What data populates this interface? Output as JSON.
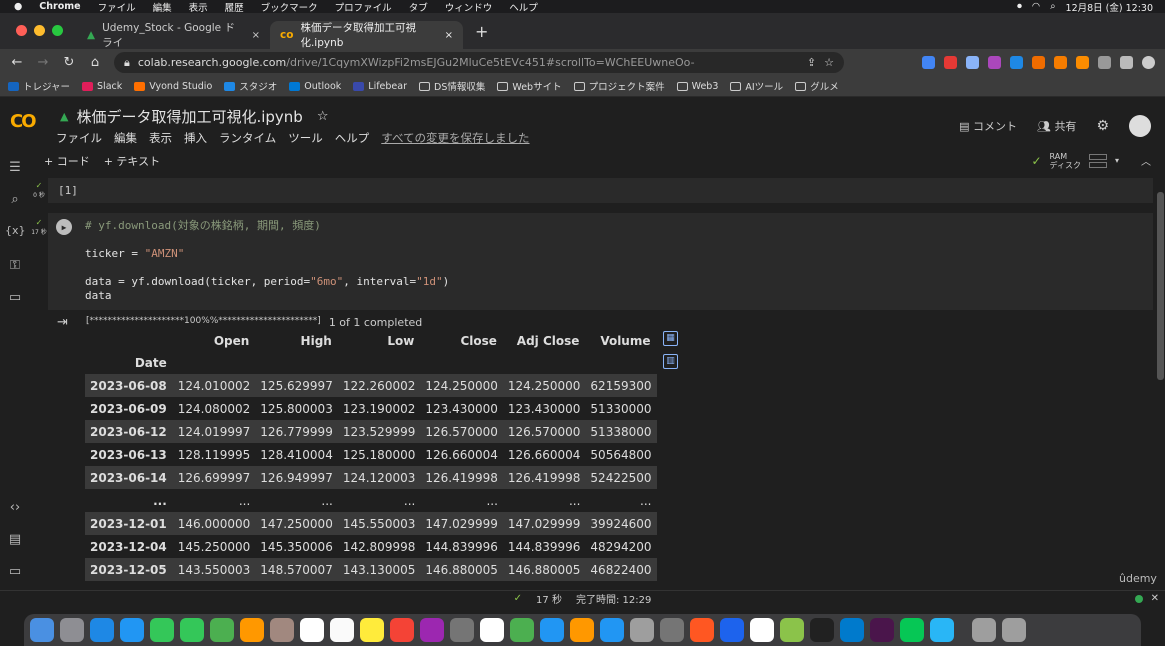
{
  "mac_menubar": {
    "app": "Chrome",
    "items": [
      "ファイル",
      "編集",
      "表示",
      "履歴",
      "ブックマーク",
      "プロファイル",
      "タブ",
      "ウィンドウ",
      "ヘルプ"
    ],
    "clock": "12月8日 (金)  12:30"
  },
  "tabs": [
    {
      "label": "Udemy_Stock - Google ドライ",
      "close": "×"
    },
    {
      "label": "株価データ取得加工可視化.ipynb",
      "close": "×"
    }
  ],
  "new_tab": "+",
  "address": {
    "host": "colab.research.google.com",
    "path": "/drive/1CqymXWizpFi2msEJGu2MluCe5tEVc451#scrollTo=WChEEUwneOo-"
  },
  "bookmarks": [
    "トレジャー",
    "Slack",
    "Vyond Studio",
    "スタジオ",
    "Outlook",
    "Lifebear",
    "DS情報収集",
    "Webサイト",
    "プロジェクト案件",
    "Web3",
    "AIツール",
    "グルメ"
  ],
  "colab": {
    "logo": "CO",
    "title": "株価データ取得加工可視化.ipynb",
    "star": "☆",
    "menus": [
      "ファイル",
      "編集",
      "表示",
      "挿入",
      "ランタイム",
      "ツール",
      "ヘルプ"
    ],
    "saved": "すべての変更を保存しました",
    "comment": "コメント",
    "share": "共有",
    "add_code": "+ コード",
    "add_text": "+ テキスト",
    "ram": "RAM",
    "disk": "ディスク"
  },
  "cell1": {
    "prompt": "[1]",
    "time": "0 秒"
  },
  "cell2": {
    "time": "17 秒",
    "lines": {
      "comment": "# yf.download(対象の株銘柄, 期間, 頻度)",
      "ticker_pre": "ticker = ",
      "ticker_val": "\"AMZN\"",
      "dl_pre": "data = yf.download(ticker, period=",
      "dl_period": "\"6mo\"",
      "dl_mid": ", interval=",
      "dl_interval": "\"1d\"",
      "dl_post": ")",
      "data": "data"
    }
  },
  "output": {
    "progress_bar": "[*********************100%%**********************]",
    "progress_text": "1 of 1 completed",
    "columns": [
      "Open",
      "High",
      "Low",
      "Close",
      "Adj Close",
      "Volume"
    ],
    "index_name": "Date",
    "rows": [
      [
        "2023-06-08",
        "124.010002",
        "125.629997",
        "122.260002",
        "124.250000",
        "124.250000",
        "62159300"
      ],
      [
        "2023-06-09",
        "124.080002",
        "125.800003",
        "123.190002",
        "123.430000",
        "123.430000",
        "51330000"
      ],
      [
        "2023-06-12",
        "124.019997",
        "126.779999",
        "123.529999",
        "126.570000",
        "126.570000",
        "51338000"
      ],
      [
        "2023-06-13",
        "128.119995",
        "128.410004",
        "125.180000",
        "126.660004",
        "126.660004",
        "50564800"
      ],
      [
        "2023-06-14",
        "126.699997",
        "126.949997",
        "124.120003",
        "126.419998",
        "126.419998",
        "52422500"
      ],
      [
        "...",
        "...",
        "...",
        "...",
        "...",
        "...",
        "..."
      ],
      [
        "2023-12-01",
        "146.000000",
        "147.250000",
        "145.550003",
        "147.029999",
        "147.029999",
        "39924600"
      ],
      [
        "2023-12-04",
        "145.250000",
        "145.350006",
        "142.809998",
        "144.839996",
        "144.839996",
        "48294200"
      ],
      [
        "2023-12-05",
        "143.550003",
        "148.570007",
        "143.130005",
        "146.880005",
        "146.880005",
        "46822400"
      ]
    ]
  },
  "watermark": "ûdemy",
  "statusbar": {
    "check": "✓",
    "time": "17 秒",
    "done": "完了時間: 12:29"
  }
}
